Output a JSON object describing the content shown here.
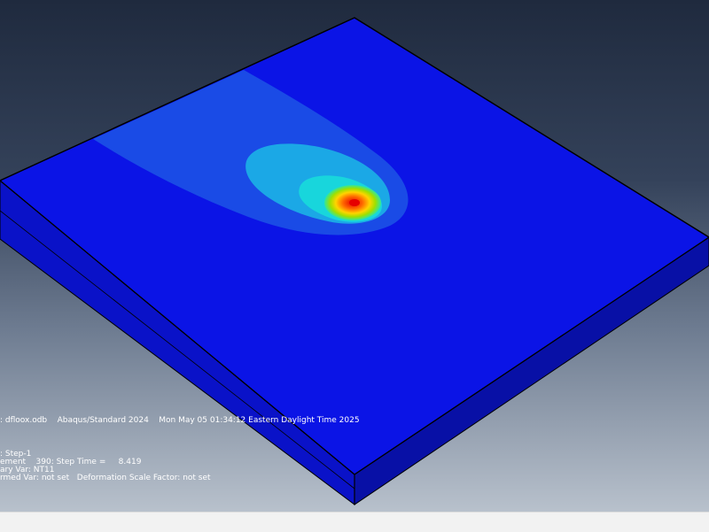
{
  "colors": {
    "background_top": "#1f2a3e",
    "background_bottom": "#b8c1cc",
    "base_contour": "#0b14e6",
    "side_face": "#0a12c8",
    "side_face_dark": "#0810a6",
    "edge_line": "#000000",
    "contour_level_1": "#1a4be6",
    "contour_level_2": "#1ba8e6",
    "contour_level_3": "#18d6dc",
    "contour_level_4": "#2fe6a0",
    "contour_level_5": "#9ee000",
    "contour_level_6": "#ffd400",
    "contour_level_7": "#ff6a00",
    "contour_max": "#e60000",
    "status_bar": "#f2f2f2"
  },
  "viewport_info": {
    "odb_line": ": dfloox.odb    Abaqus/Standard 2024    Mon May 05 01:34:12 Eastern Daylight Time 2025",
    "step_line": ": Step-1",
    "increment_line": "ement    390: Step Time =     8.419",
    "primary_var_line": "ary Var: NT11",
    "deformed_var_line": "rmed Var: not set   Deformation Scale Factor: not set"
  }
}
